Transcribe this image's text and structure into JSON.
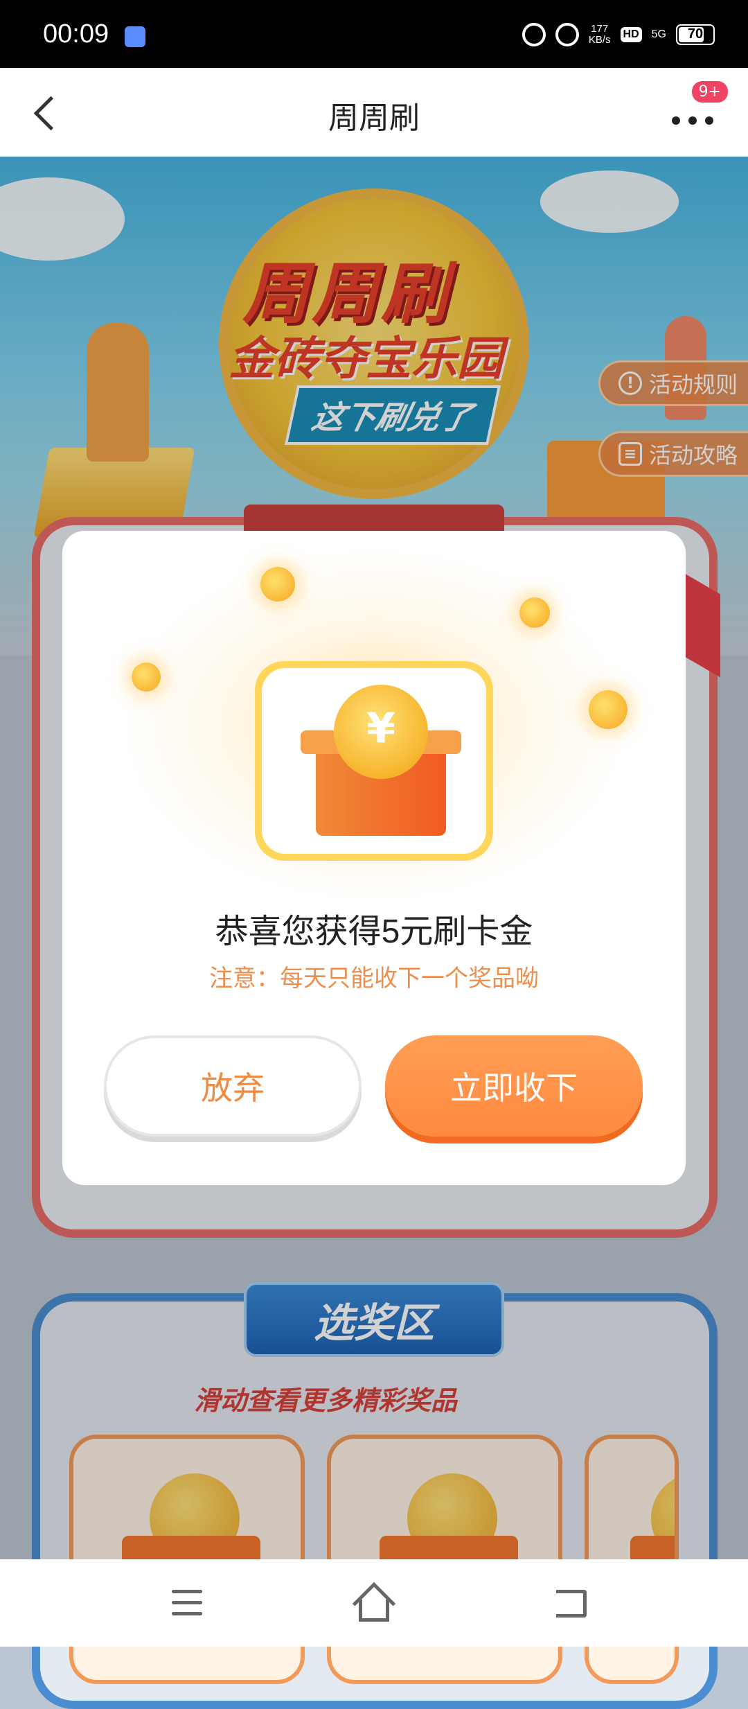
{
  "status_bar": {
    "time": "00:09",
    "net_speed_value": "177",
    "net_speed_unit": "KB/s",
    "hd_label": "HD",
    "signal_label": "5G",
    "battery": "70"
  },
  "nav": {
    "title": "周周刷",
    "badge": "9+"
  },
  "hero": {
    "title": "周周刷",
    "subtitle": "金砖夺宝乐园",
    "slogan": "这下刷兑了",
    "rules_button": "活动规则",
    "guide_button": "活动攻略"
  },
  "prize_section": {
    "title": "选奖区",
    "hint": "滑动查看更多精彩奖品"
  },
  "modal": {
    "title": "恭喜您获得5元刷卡金",
    "note": "注意：每天只能收下一个奖品呦",
    "cancel_button": "放弃",
    "confirm_button": "立即收下",
    "coin_symbol": "¥"
  },
  "colors": {
    "accent": "#ff8a3e",
    "note": "#ef8d4b",
    "badge": "#f04364"
  }
}
